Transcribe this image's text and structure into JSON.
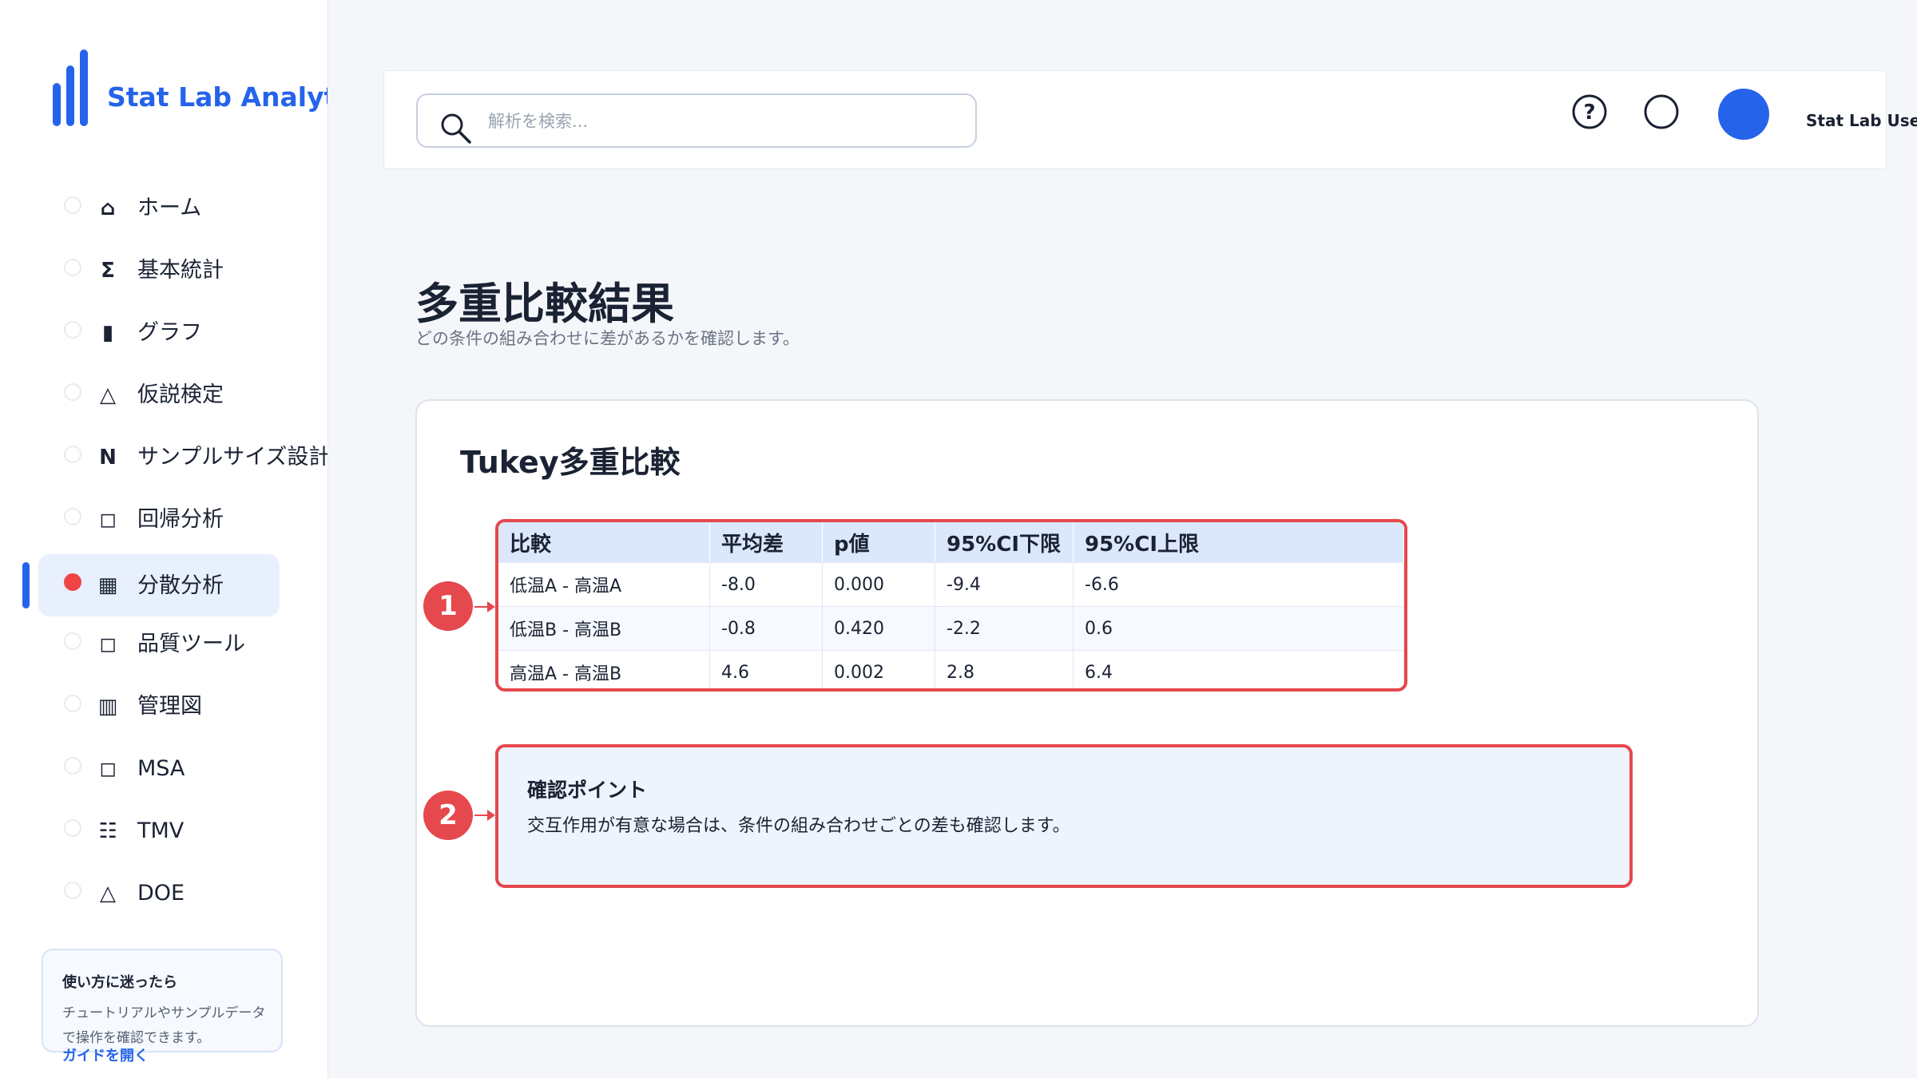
{
  "app": {
    "name": "Stat Lab Analytics"
  },
  "sidebar": {
    "items": [
      {
        "icon": "home-icon",
        "glyph": "⌂",
        "label": "ホーム",
        "active": false
      },
      {
        "icon": "sigma-icon",
        "glyph": "Σ",
        "label": "基本統計",
        "active": false
      },
      {
        "icon": "bar-chart-icon",
        "glyph": "▮",
        "label": "グラフ",
        "active": false
      },
      {
        "icon": "triangle-icon",
        "glyph": "△",
        "label": "仮説検定",
        "active": false
      },
      {
        "icon": "n-icon",
        "glyph": "N",
        "label": "サンプルサイズ設計",
        "active": false
      },
      {
        "icon": "square-icon",
        "glyph": "◻",
        "label": "回帰分析",
        "active": false
      },
      {
        "icon": "grid-icon",
        "glyph": "▦",
        "label": "分散分析",
        "active": true
      },
      {
        "icon": "square-icon",
        "glyph": "◻",
        "label": "品質ツール",
        "active": false
      },
      {
        "icon": "columns-icon",
        "glyph": "▥",
        "label": "管理図",
        "active": false
      },
      {
        "icon": "square-icon",
        "glyph": "◻",
        "label": "MSA",
        "active": false
      },
      {
        "icon": "list-icon",
        "glyph": "☷",
        "label": "TMV",
        "active": false
      },
      {
        "icon": "triangle-icon",
        "glyph": "△",
        "label": "DOE",
        "active": false
      }
    ],
    "help": {
      "title": "使い方に迷ったら",
      "description": "チュートリアルやサンプルデータで操作を確認できます。",
      "link": "ガイドを開く"
    }
  },
  "header": {
    "search_placeholder": "解析を検索...",
    "user_name": "Stat Lab User"
  },
  "main": {
    "title": "多重比較結果",
    "subtitle": "どの条件の組み合わせに差があるかを確認します。",
    "card": {
      "title": "Tukey多重比較",
      "table": {
        "columns": [
          "比較",
          "平均差",
          "p値",
          "95%CI下限",
          "95%CI上限"
        ],
        "rows": [
          [
            "低温A - 高温A",
            "-8.0",
            "0.000",
            "-9.4",
            "-6.6"
          ],
          [
            "低温B - 高温B",
            "-0.8",
            "0.420",
            "-2.2",
            "0.6"
          ],
          [
            "高温A - 高温B",
            "4.6",
            "0.002",
            "2.8",
            "6.4"
          ]
        ]
      },
      "callout": {
        "title": "確認ポイント",
        "text": "交互作用が有意な場合は、条件の組み合わせごとの差も確認します。"
      },
      "markers": [
        "1",
        "2"
      ]
    }
  },
  "colors": {
    "accent": "#2563eb",
    "annotation": "#e5484d",
    "active_bg": "#e8f0fd"
  }
}
